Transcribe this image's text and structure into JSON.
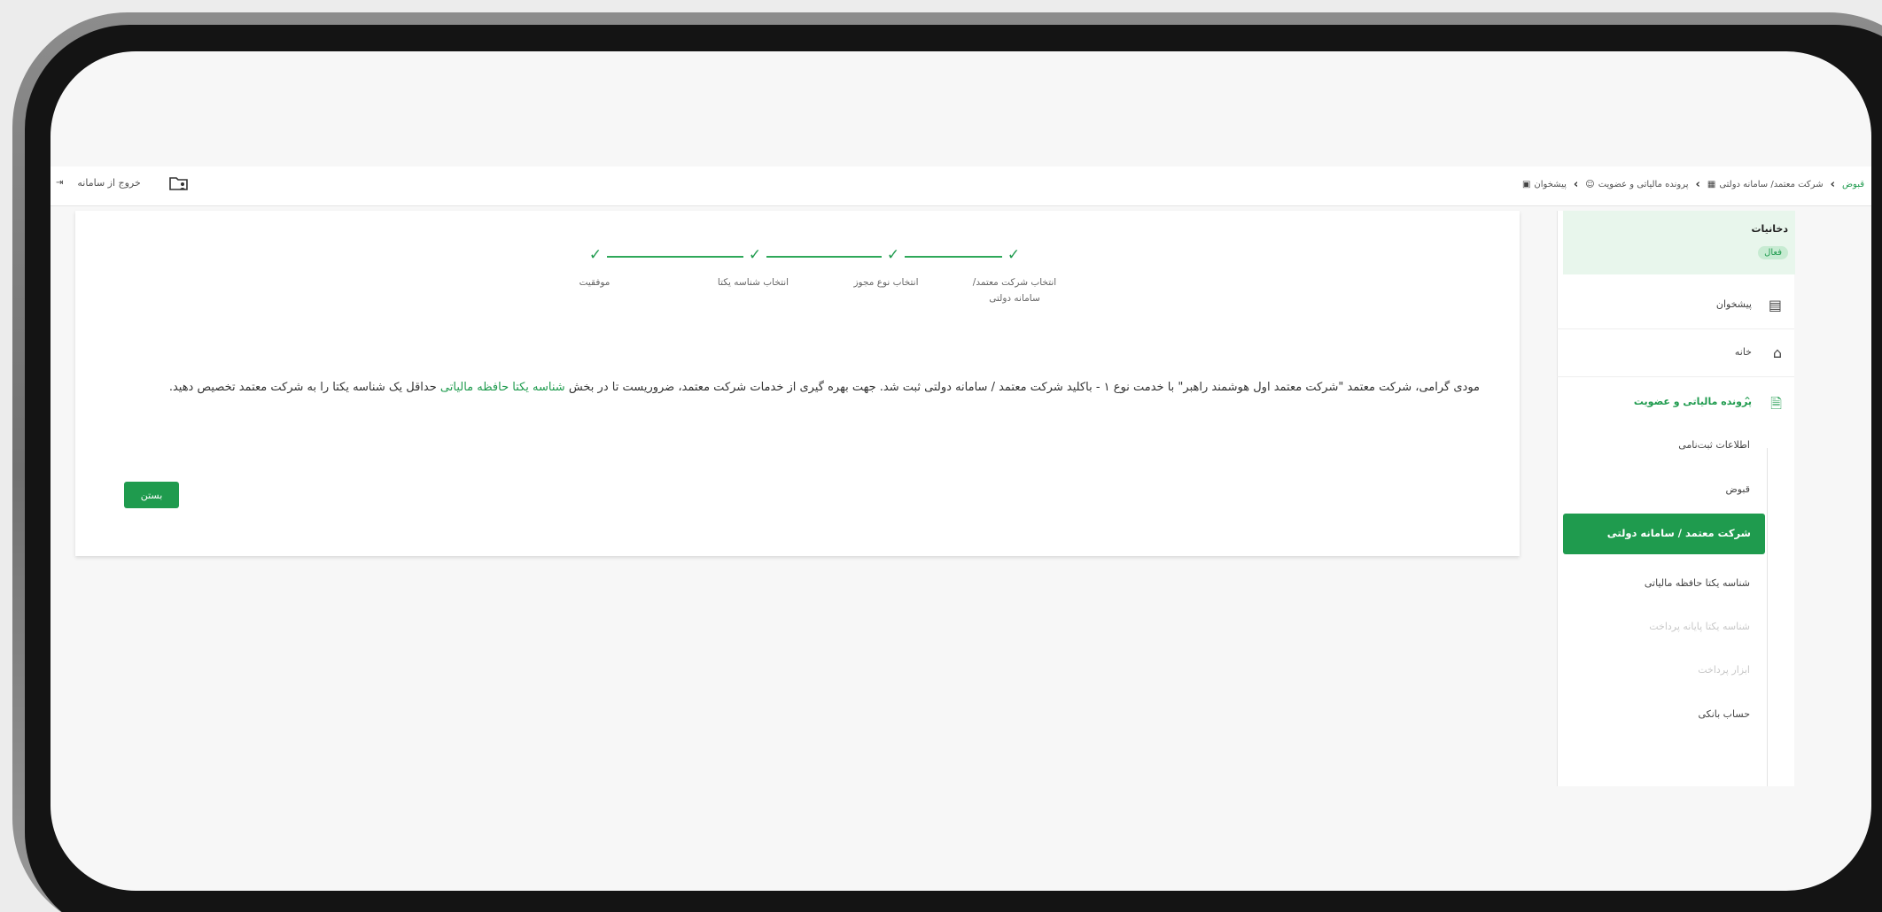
{
  "topbar": {
    "breadcrumb": [
      {
        "label": "پیشخوان",
        "icon": "dashboard-icon"
      },
      {
        "label": "پرونده مالیاتی و عضویت",
        "icon": "users-icon"
      },
      {
        "label": "شرکت معتمد/ سامانه دولتی",
        "icon": "building-icon"
      },
      {
        "label": "قبوض",
        "icon": "",
        "active": true
      }
    ],
    "logout_label": "خروج از سامانه",
    "logout_icon": "logout-icon",
    "folder_icon": "folder-user-icon"
  },
  "stepper": {
    "steps": [
      {
        "label": "انتخاب شرکت معتمد/سامانه دولتی",
        "done": true
      },
      {
        "label": "انتخاب نوع مجوز",
        "done": true
      },
      {
        "label": "انتخاب شناسه یکتا",
        "done": true
      },
      {
        "label": "موفقیت",
        "done": true
      }
    ]
  },
  "message": {
    "part1": "مودی گرامی، شرکت معتمد \"شرکت معتمد اول هوشمند راهبر\" با خدمت نوع ۱ - باکلید شرکت معتمد / سامانه دولتی ثبت شد. جهت بهره گیری از خدمات شرکت معتمد، ضروریست تا در بخش",
    "highlight": "شناسه یکتا حافظه مالیاتی",
    "part2": "حداقل یک شناسه یکتا را به شرکت معتمد تخصیص دهید."
  },
  "close_button": {
    "label": "بستن"
  },
  "sidebar": {
    "header": {
      "title": "دخانیات",
      "status": "فعال"
    },
    "items": [
      {
        "label": "پیشخوان",
        "icon": "dashboard-icon"
      },
      {
        "label": "خانه",
        "icon": "home-icon"
      },
      {
        "label": "پرونده مالیاتی و عضویت",
        "icon": "document-icon",
        "open": true,
        "chevron_icon": "chevron-up-icon"
      }
    ],
    "subitems": [
      {
        "label": "اطلاعات ثبت‌نامی",
        "enabled": true
      },
      {
        "label": "قبوض",
        "enabled": true
      },
      {
        "label": "شرکت معتمد / سامانه دولتی",
        "active": true
      },
      {
        "label": "شناسه یکتا حافظه مالیاتی",
        "enabled": true
      },
      {
        "label": "شناسه یکتا پایانه پرداخت",
        "enabled": false
      },
      {
        "label": "ابزار پرداخت",
        "enabled": false
      },
      {
        "label": "حساب بانکی",
        "enabled": true
      }
    ]
  },
  "colors": {
    "accent": "#1f9b4e",
    "accent_light": "#e8f6ec"
  }
}
